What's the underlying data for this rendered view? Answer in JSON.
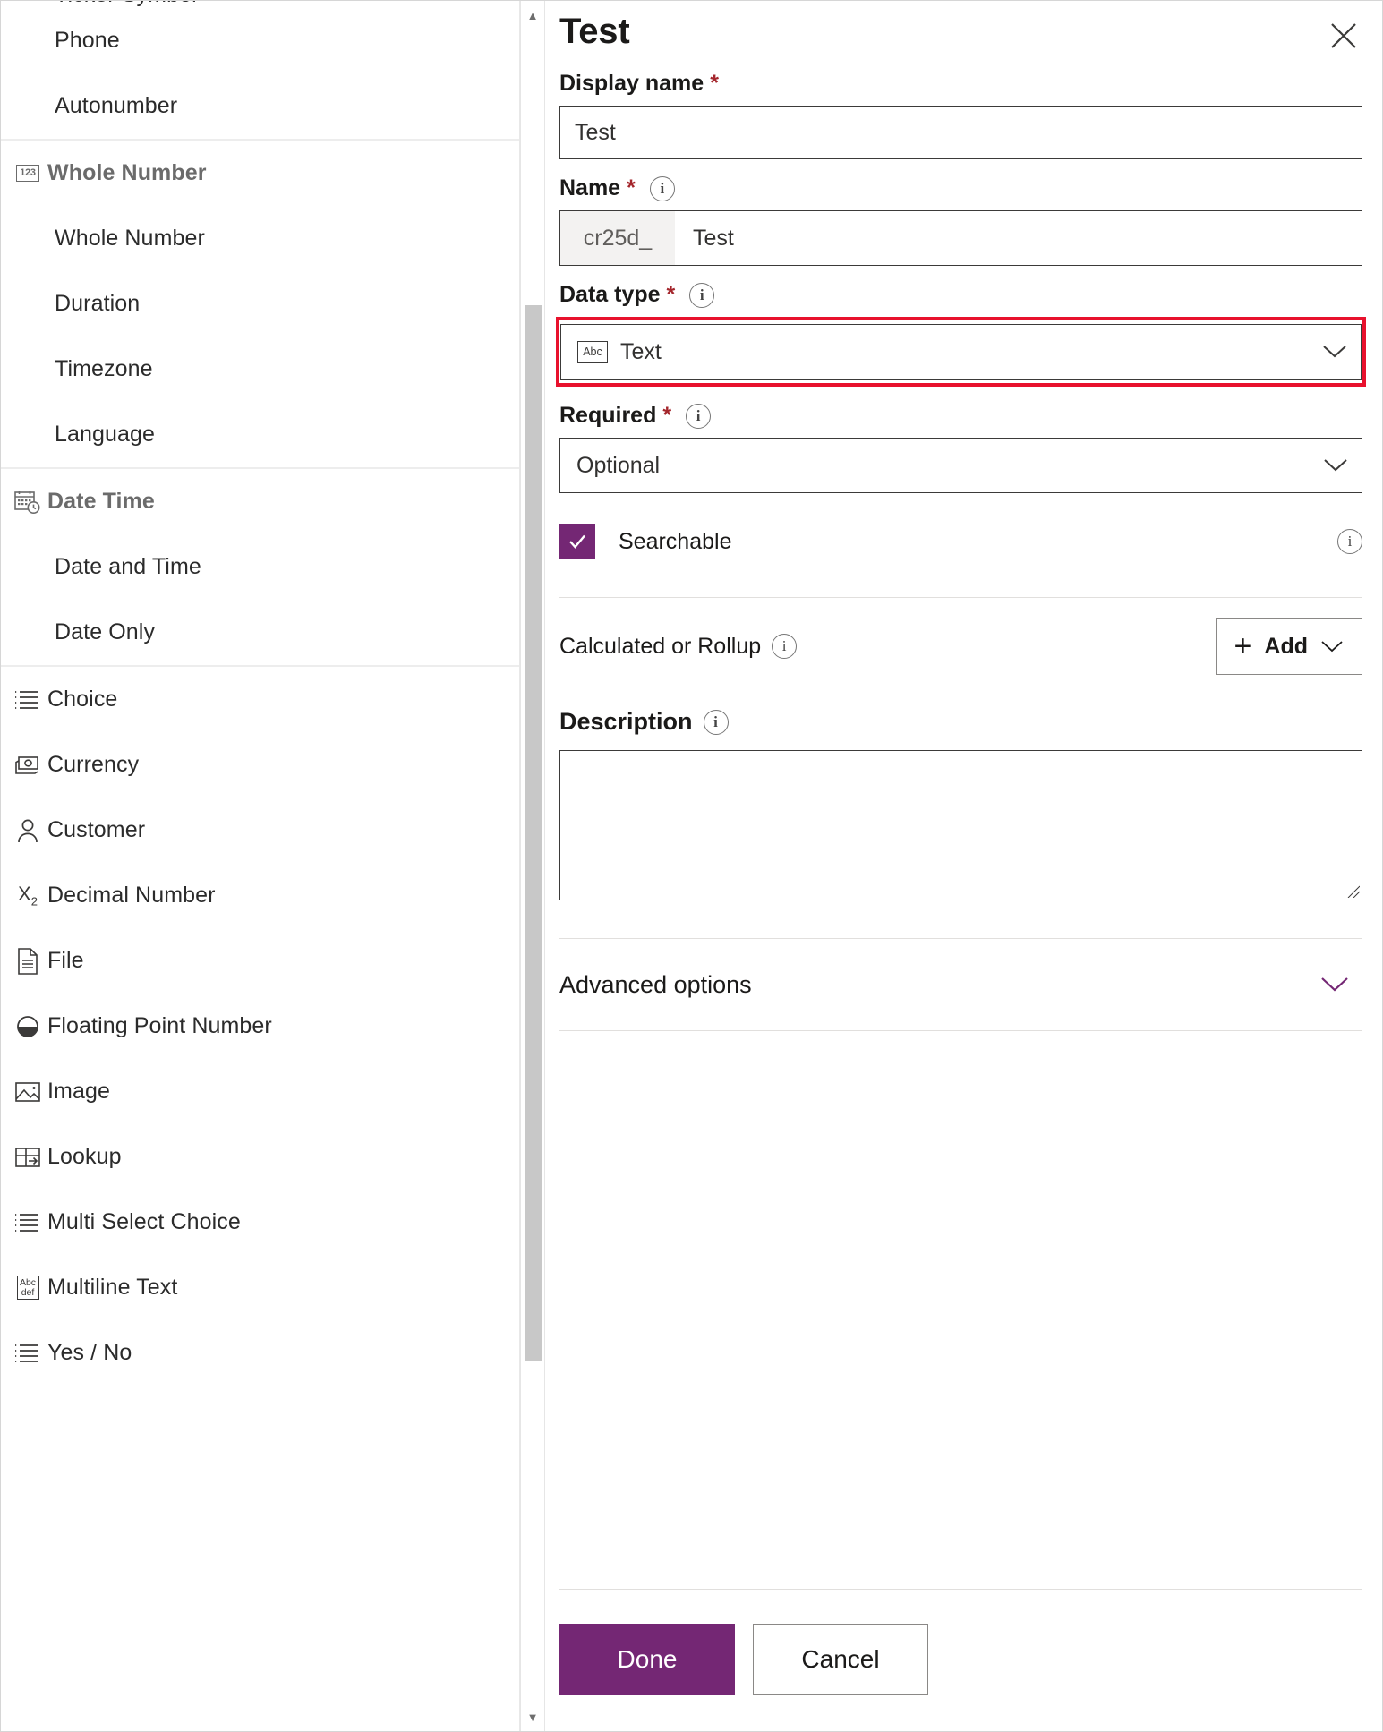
{
  "data_type_list": {
    "cutoff_top_item": "Ticker Symbol",
    "groups": [
      {
        "header": null,
        "items": [
          {
            "label": "Phone",
            "icon": null,
            "level": "child"
          },
          {
            "label": "Autonumber",
            "icon": null,
            "level": "child"
          }
        ]
      },
      {
        "header": {
          "label": "Whole Number",
          "icon": "123-box-icon"
        },
        "items": [
          {
            "label": "Whole Number",
            "icon": null,
            "level": "child"
          },
          {
            "label": "Duration",
            "icon": null,
            "level": "child"
          },
          {
            "label": "Timezone",
            "icon": null,
            "level": "child"
          },
          {
            "label": "Language",
            "icon": null,
            "level": "child"
          }
        ]
      },
      {
        "header": {
          "label": "Date Time",
          "icon": "calendar-clock-icon"
        },
        "items": [
          {
            "label": "Date and Time",
            "icon": null,
            "level": "child"
          },
          {
            "label": "Date Only",
            "icon": null,
            "level": "child"
          }
        ]
      },
      {
        "header": null,
        "items": [
          {
            "label": "Choice",
            "icon": "list-icon",
            "level": "top"
          },
          {
            "label": "Currency",
            "icon": "banknote-icon",
            "level": "top"
          },
          {
            "label": "Customer",
            "icon": "person-icon",
            "level": "top"
          },
          {
            "label": "Decimal Number",
            "icon": "x-subscript-2-icon",
            "level": "top"
          },
          {
            "label": "File",
            "icon": "document-icon",
            "level": "top"
          },
          {
            "label": "Floating Point Number",
            "icon": "half-filled-circle-icon",
            "level": "top"
          },
          {
            "label": "Image",
            "icon": "picture-icon",
            "level": "top"
          },
          {
            "label": "Lookup",
            "icon": "lookup-table-arrow-icon",
            "level": "top"
          },
          {
            "label": "Multi Select Choice",
            "icon": "list-icon",
            "level": "top"
          },
          {
            "label": "Multiline Text",
            "icon": "abc-def-box-icon",
            "level": "top"
          },
          {
            "label": "Yes / No",
            "icon": "list-icon",
            "level": "top"
          }
        ]
      }
    ]
  },
  "panel": {
    "title": "Test",
    "close_icon": "close-icon",
    "display_name": {
      "label": "Display name",
      "required_marker": "*",
      "value": "Test"
    },
    "name": {
      "label": "Name",
      "required_marker": "*",
      "info_icon": "info-icon",
      "prefix": "cr25d_",
      "value": "Test"
    },
    "data_type": {
      "label": "Data type",
      "required_marker": "*",
      "info_icon": "info-icon",
      "selected": "Text",
      "selected_icon": "abc-box-icon",
      "chevron_icon": "chevron-down-icon",
      "highlight_color": "#e8112d"
    },
    "required": {
      "label": "Required",
      "required_marker": "*",
      "info_icon": "info-icon",
      "selected": "Optional",
      "chevron_icon": "chevron-down-icon"
    },
    "searchable": {
      "label": "Searchable",
      "checked": true,
      "check_icon": "checkmark-icon",
      "info_icon": "info-icon",
      "accent_color": "#742774"
    },
    "calculated_or_rollup": {
      "label": "Calculated or Rollup",
      "info_icon": "info-icon",
      "add_label": "Add",
      "plus_icon": "plus-icon",
      "chevron_icon": "chevron-down-icon"
    },
    "description": {
      "label": "Description",
      "info_icon": "info-icon",
      "value": ""
    },
    "advanced_options": {
      "label": "Advanced options",
      "chevron_icon": "chevron-down-icon"
    },
    "footer": {
      "done_label": "Done",
      "cancel_label": "Cancel"
    }
  }
}
